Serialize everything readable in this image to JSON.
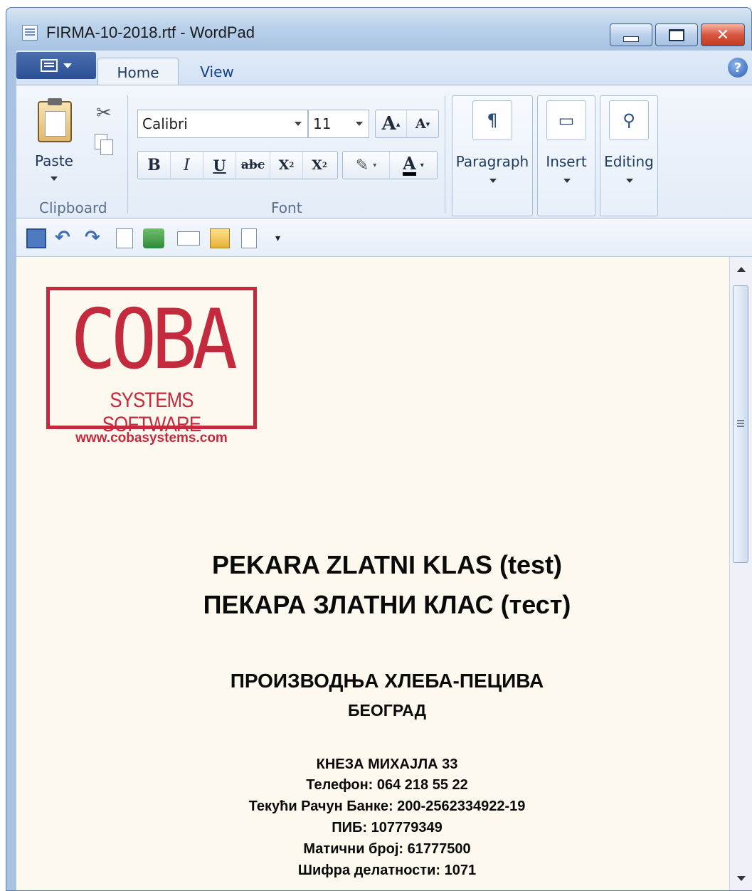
{
  "window": {
    "title": "FIRMA-10-2018.rtf - WordPad",
    "controls": {
      "minimize": "minimize",
      "maximize": "maximize",
      "close": "close"
    }
  },
  "tabs": [
    {
      "label": "Home",
      "active": true
    },
    {
      "label": "View",
      "active": false
    }
  ],
  "ribbon": {
    "clipboard": {
      "paste_label": "Paste",
      "group_label": "Clipboard"
    },
    "font": {
      "family": "Calibri",
      "size": "11",
      "group_label": "Font",
      "buttons": {
        "grow": "A",
        "shrink": "A",
        "bold": "B",
        "italic": "I",
        "underline": "U",
        "strike": "abc",
        "subscript": "X",
        "superscript": "X",
        "color": "A"
      }
    },
    "paragraph": {
      "label": "Paragraph"
    },
    "insert": {
      "label": "Insert"
    },
    "editing": {
      "label": "Editing"
    }
  },
  "document": {
    "logo": {
      "main": "COBA",
      "sub": "SYSTEMS SOFTWARE",
      "url": "www.cobasystems.com"
    },
    "lines": [
      "PEKARA ZLATNI KLAS (test)",
      "ПЕКАРА ЗЛАТНИ КЛАС (тест)",
      "ПРОИЗВОДЊА ХЛЕБА-ПЕЦИВА",
      "БЕОГРАД",
      "КНЕЗА МИХАЈЛА 33",
      "Телефон: 064 218 55 22",
      "Текући Рачун Банке: 200-2562334922-19",
      "ПИБ: 107779349",
      "Матични број: 61777500",
      "Шифра делатности: 1071"
    ]
  },
  "colors": {
    "logo": "#c42a3e",
    "page": "#fdf9ee",
    "chrome": "#d4e3f4"
  }
}
